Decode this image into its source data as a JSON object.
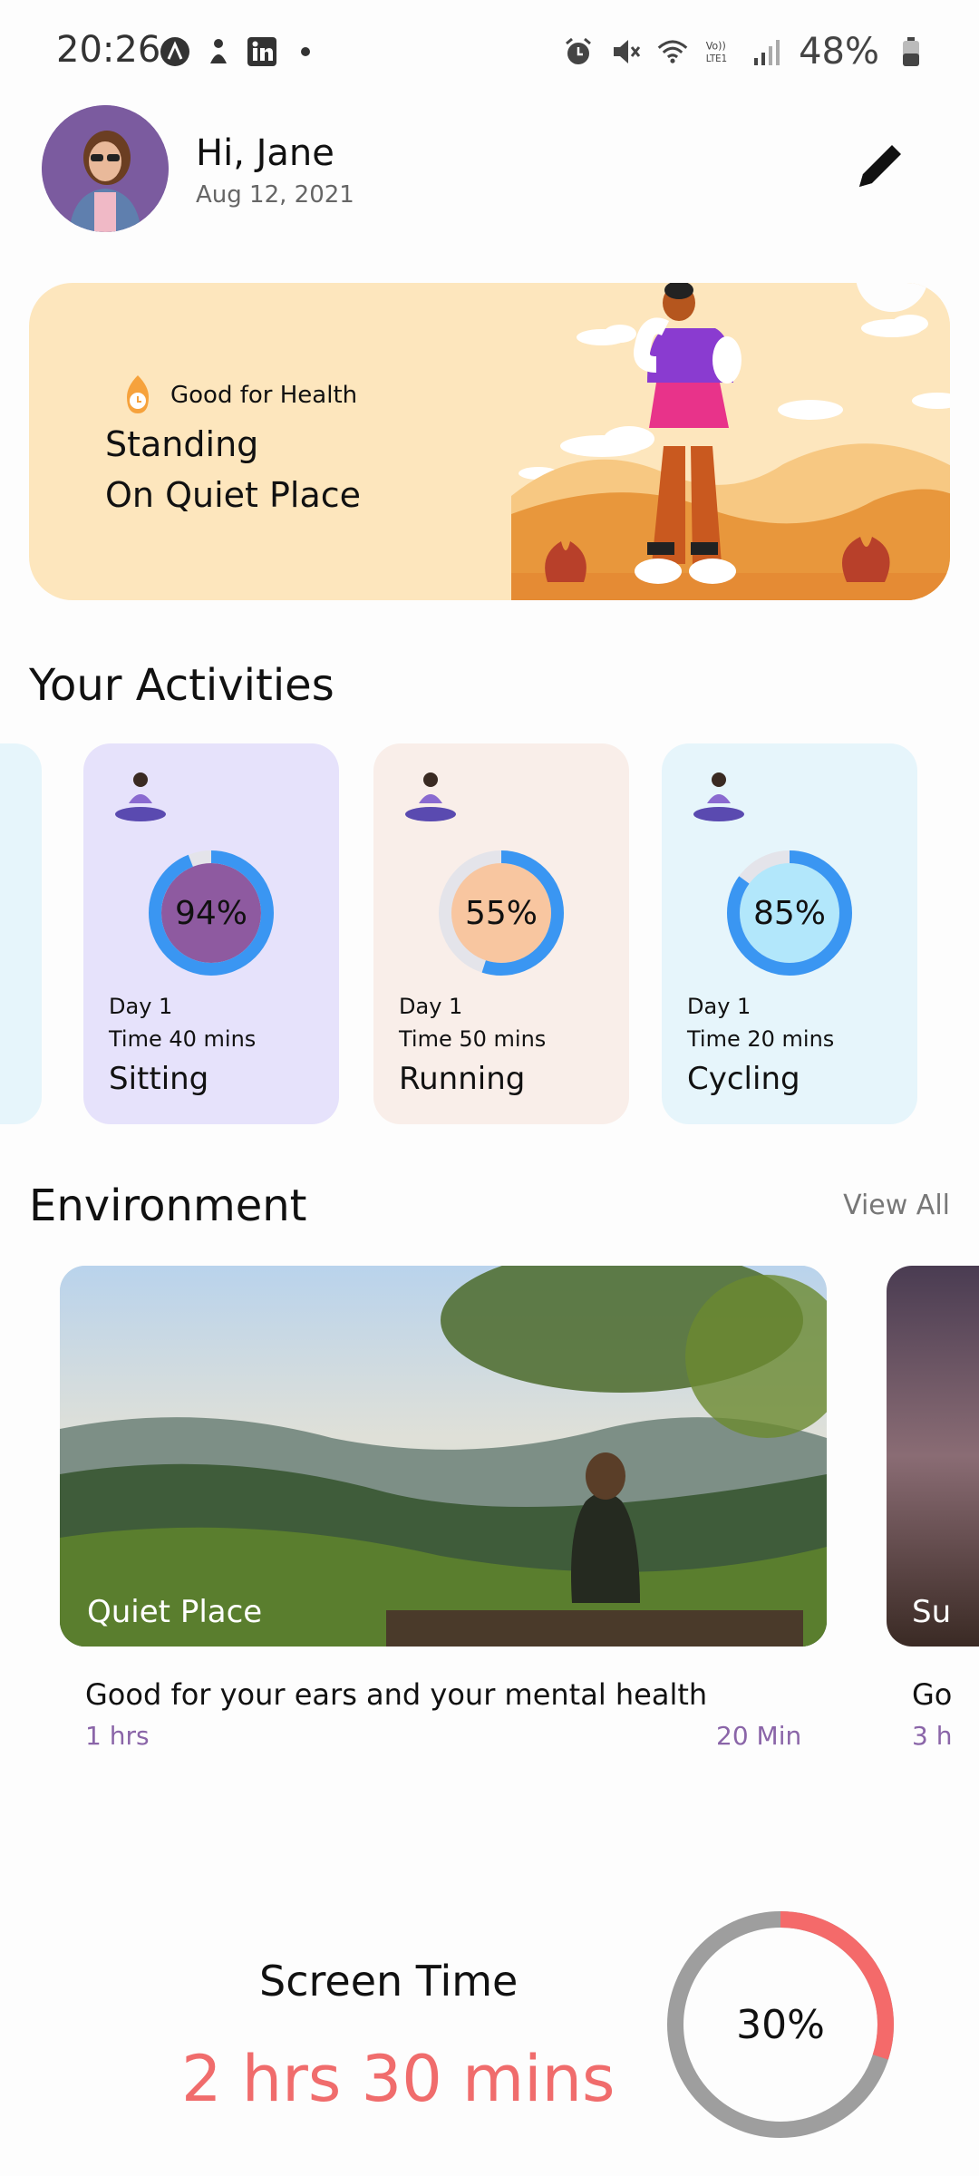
{
  "status_bar": {
    "time": "20:26",
    "battery": "48%",
    "left_icons": [
      "a-icon",
      "figure-icon",
      "linkedin-icon",
      "dot-icon"
    ],
    "right_icons": [
      "alarm-icon",
      "mute-icon",
      "wifi-icon",
      "volte-icon",
      "signal-icon",
      "battery-icon"
    ]
  },
  "header": {
    "greeting": "Hi, Jane",
    "date": "Aug 12, 2021"
  },
  "banner": {
    "tag": "Good for Health",
    "title": "Standing\nOn Quiet Place"
  },
  "activities": {
    "title": "Your Activities",
    "cards": [
      {
        "percent": "94%",
        "value": 94,
        "day": "Day 1",
        "time": "Time 40 mins",
        "name": "Sitting",
        "bg": "#e6e2fb",
        "fill": "#8e5aa0"
      },
      {
        "percent": "55%",
        "value": 55,
        "day": "Day 1",
        "time": "Time 50 mins",
        "name": "Running",
        "bg": "#f9eee9",
        "fill": "#f8c6a0"
      },
      {
        "percent": "85%",
        "value": 85,
        "day": "Day 1",
        "time": "Time 20 mins",
        "name": "Cycling",
        "bg": "#e6f5fb",
        "fill": "#b2e7fb"
      }
    ]
  },
  "environment": {
    "title": "Environment",
    "view_all": "View All",
    "items": [
      {
        "label": "Quiet Place",
        "description": "Good for your ears and your mental health",
        "duration": "1 hrs",
        "minutes": "20 Min"
      },
      {
        "label": "Su",
        "description": "Go",
        "duration": "3 h"
      }
    ]
  },
  "screen_time": {
    "label": "Screen Time",
    "value": "2 hrs 30 mins",
    "percent": "30%",
    "fraction": 0.3,
    "accent": "#f46a6a"
  }
}
